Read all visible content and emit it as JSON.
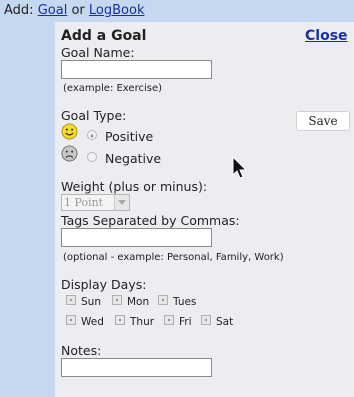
{
  "topbar": {
    "add_label": "Add:",
    "goal_link": "Goal",
    "or_text": "or",
    "logbook_link": "LogBook"
  },
  "dialog": {
    "title": "Add a Goal",
    "close_label": "Close",
    "goal_name_label": "Goal Name:",
    "goal_name_value": "",
    "goal_name_hint": "(example: Exercise)",
    "goal_type_label": "Goal Type:",
    "positive_label": "Positive",
    "negative_label": "Negative",
    "save_label": "Save",
    "weight_label": "Weight (plus or minus):",
    "weight_selected": "1 Point",
    "tags_label": "Tags Separated by Commas:",
    "tags_value": "",
    "tags_hint": "(optional - example: Personal, Family, Work)",
    "display_days_label": "Display Days:",
    "days": [
      "Sun",
      "Mon",
      "Tues",
      "Wed",
      "Thur",
      "Fri",
      "Sat"
    ],
    "notes_label": "Notes:",
    "notes_value": ""
  },
  "colors": {
    "background": "#c5d8f0",
    "panel": "#ecedf1",
    "link": "#1a2fa0"
  },
  "icons": [
    "happy-face-icon",
    "sad-face-icon",
    "mouse-cursor-icon",
    "dropdown-arrow-icon"
  ]
}
